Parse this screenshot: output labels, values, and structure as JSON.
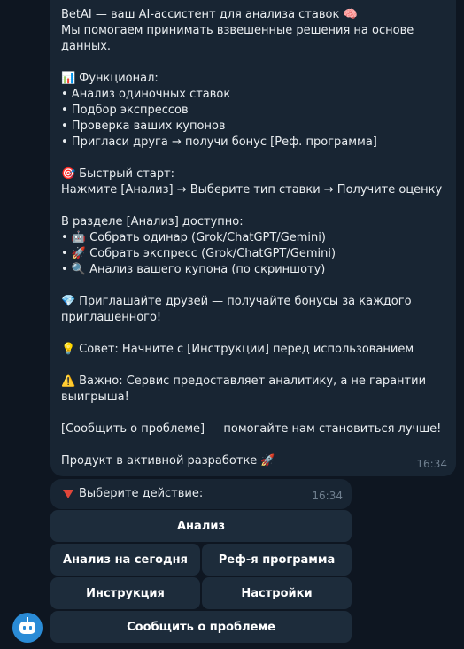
{
  "message": {
    "lines": [
      {
        "emoji": "",
        "text": "BetAI — ваш AI-ассистент для анализа ставок 🧠"
      },
      {
        "emoji": "",
        "text": "Мы помогаем принимать взвешенные решения на основе"
      },
      {
        "emoji": "",
        "text": "данных."
      },
      null,
      {
        "emoji": "📊",
        "text": "Функционал:"
      },
      {
        "emoji": "",
        "text": "• Анализ одиночных ставок"
      },
      {
        "emoji": "",
        "text": "• Подбор экспрессов"
      },
      {
        "emoji": "",
        "text": "• Проверка ваших купонов"
      },
      {
        "emoji": "",
        "text": "• Пригласи друга → получи бонус [Реф. программа]"
      },
      null,
      {
        "emoji": "🎯",
        "text": "Быстрый старт:"
      },
      {
        "emoji": "",
        "text": "Нажмите [Анализ] → Выберите тип ставки → Получите оценку"
      },
      null,
      {
        "emoji": "",
        "text": "В разделе [Анализ] доступно:"
      },
      {
        "emoji": "",
        "text": "• 🤖 Собрать одинар (Grok/ChatGPT/Gemini)"
      },
      {
        "emoji": "",
        "text": "• 🚀 Собрать экспресс (Grok/ChatGPT/Gemini)"
      },
      {
        "emoji": "",
        "text": "• 🔍 Анализ вашего купона (по скриншоту)"
      },
      null,
      {
        "emoji": "💎",
        "text": "Приглашайте друзей — получайте бонусы за каждого"
      },
      {
        "emoji": "",
        "text": "приглашенного!"
      },
      null,
      {
        "emoji": "💡",
        "text": "Совет: Начните с [Инструкции] перед использованием"
      },
      null,
      {
        "emoji": "⚠️",
        "text": "Важно: Сервис предоставляет аналитику, а не гарантии"
      },
      {
        "emoji": "",
        "text": "выигрыша!"
      },
      null,
      {
        "emoji": "",
        "text": "[Сообщить о проблеме] — помогайте нам становиться лучше!"
      },
      null,
      {
        "emoji": "",
        "text": "Продукт в активной разработке 🚀"
      }
    ],
    "time": "16:34"
  },
  "prompt": {
    "text": "Выберите действие:",
    "time": "16:34"
  },
  "keyboard": {
    "analysis": "Анализ",
    "today": "Анализ на сегодня",
    "referral": "Реф-я программа",
    "instruction": "Инструкция",
    "settings": "Настройки",
    "report": "Сообщить о проблеме"
  },
  "icons": {
    "avatar": "bot-avatar-icon",
    "prompt_marker": "red-triangle-icon"
  },
  "colors": {
    "background": "#0e1621",
    "bubble": "#182533",
    "button": "#1d2c3b",
    "avatar": "#2a8bd6"
  }
}
